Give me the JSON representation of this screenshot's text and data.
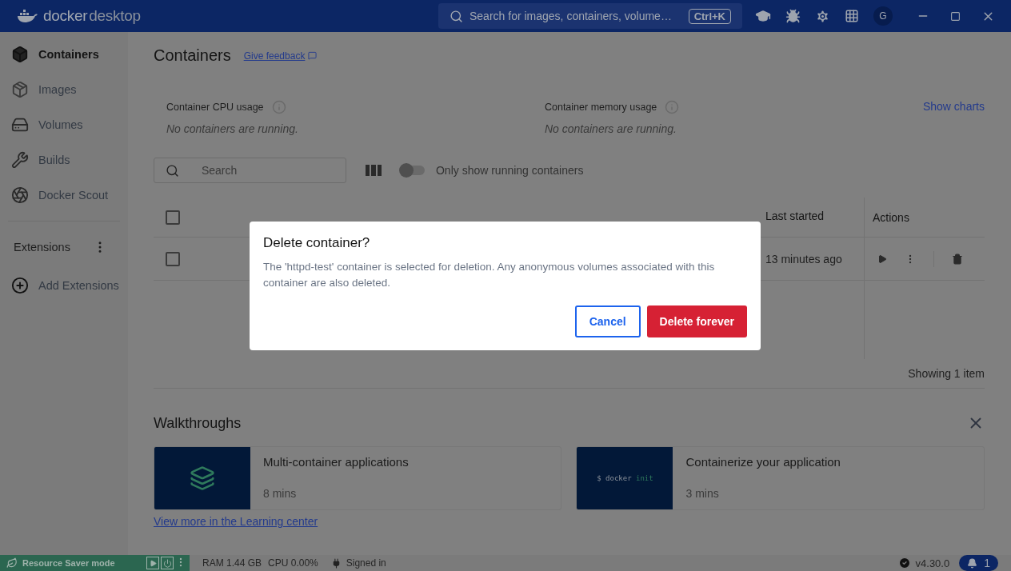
{
  "title_bar": {
    "logo": {
      "word_1": "docker",
      "word_2": "desktop"
    },
    "search": {
      "placeholder": "Search for images, containers, volume…",
      "shortcut": "Ctrl+K"
    },
    "avatar": "G"
  },
  "sidebar": {
    "items": [
      {
        "label": "Containers",
        "kind": "containers",
        "selected": true
      },
      {
        "label": "Images",
        "kind": "images",
        "selected": false
      },
      {
        "label": "Volumes",
        "kind": "volumes",
        "selected": false
      },
      {
        "label": "Builds",
        "kind": "builds",
        "selected": false
      },
      {
        "label": "Docker Scout",
        "kind": "scout",
        "selected": false
      }
    ],
    "extensions": {
      "label": "Extensions",
      "add": "Add Extensions"
    }
  },
  "main": {
    "title": "Containers",
    "feedback": "Give feedback",
    "stats": [
      {
        "label": "Container CPU usage",
        "value": "No containers are running."
      },
      {
        "label": "Container memory usage",
        "value": "No containers are running."
      }
    ],
    "show_charts": "Show charts",
    "search": {
      "placeholder": "Search"
    },
    "toggle": {
      "label": "Only show running containers",
      "on": false
    },
    "table": {
      "header_checked": false,
      "columns": [
        "Last started",
        "Actions"
      ],
      "rows": [
        {
          "checked": false,
          "last_started": "13 minutes ago"
        }
      ],
      "footer": "Showing 1 item"
    },
    "walkthroughs": {
      "title": "Walkthroughs",
      "cards": [
        {
          "kind": "stack",
          "title": "Multi-container applications",
          "duration": "8 mins"
        },
        {
          "kind": "terminal",
          "title": "Containerize your application",
          "duration": "3 mins",
          "prompt": "$ docker",
          "command": "init"
        }
      ],
      "link": "View more in the Learning center"
    }
  },
  "status_bar": {
    "resource_saver": "Resource Saver mode",
    "ram": "RAM 1.44 GB",
    "cpu": "CPU 0.00%",
    "signed": "Signed in",
    "version": "v4.30.0",
    "notifications": "1"
  },
  "dialog": {
    "title": "Delete container?",
    "message": "The 'httpd-test' container is selected for deletion. Any anonymous volumes associated with this container are also deleted.",
    "buttons": [
      {
        "label": "Cancel",
        "kind": "secondary"
      },
      {
        "label": "Delete forever",
        "kind": "danger"
      }
    ]
  }
}
